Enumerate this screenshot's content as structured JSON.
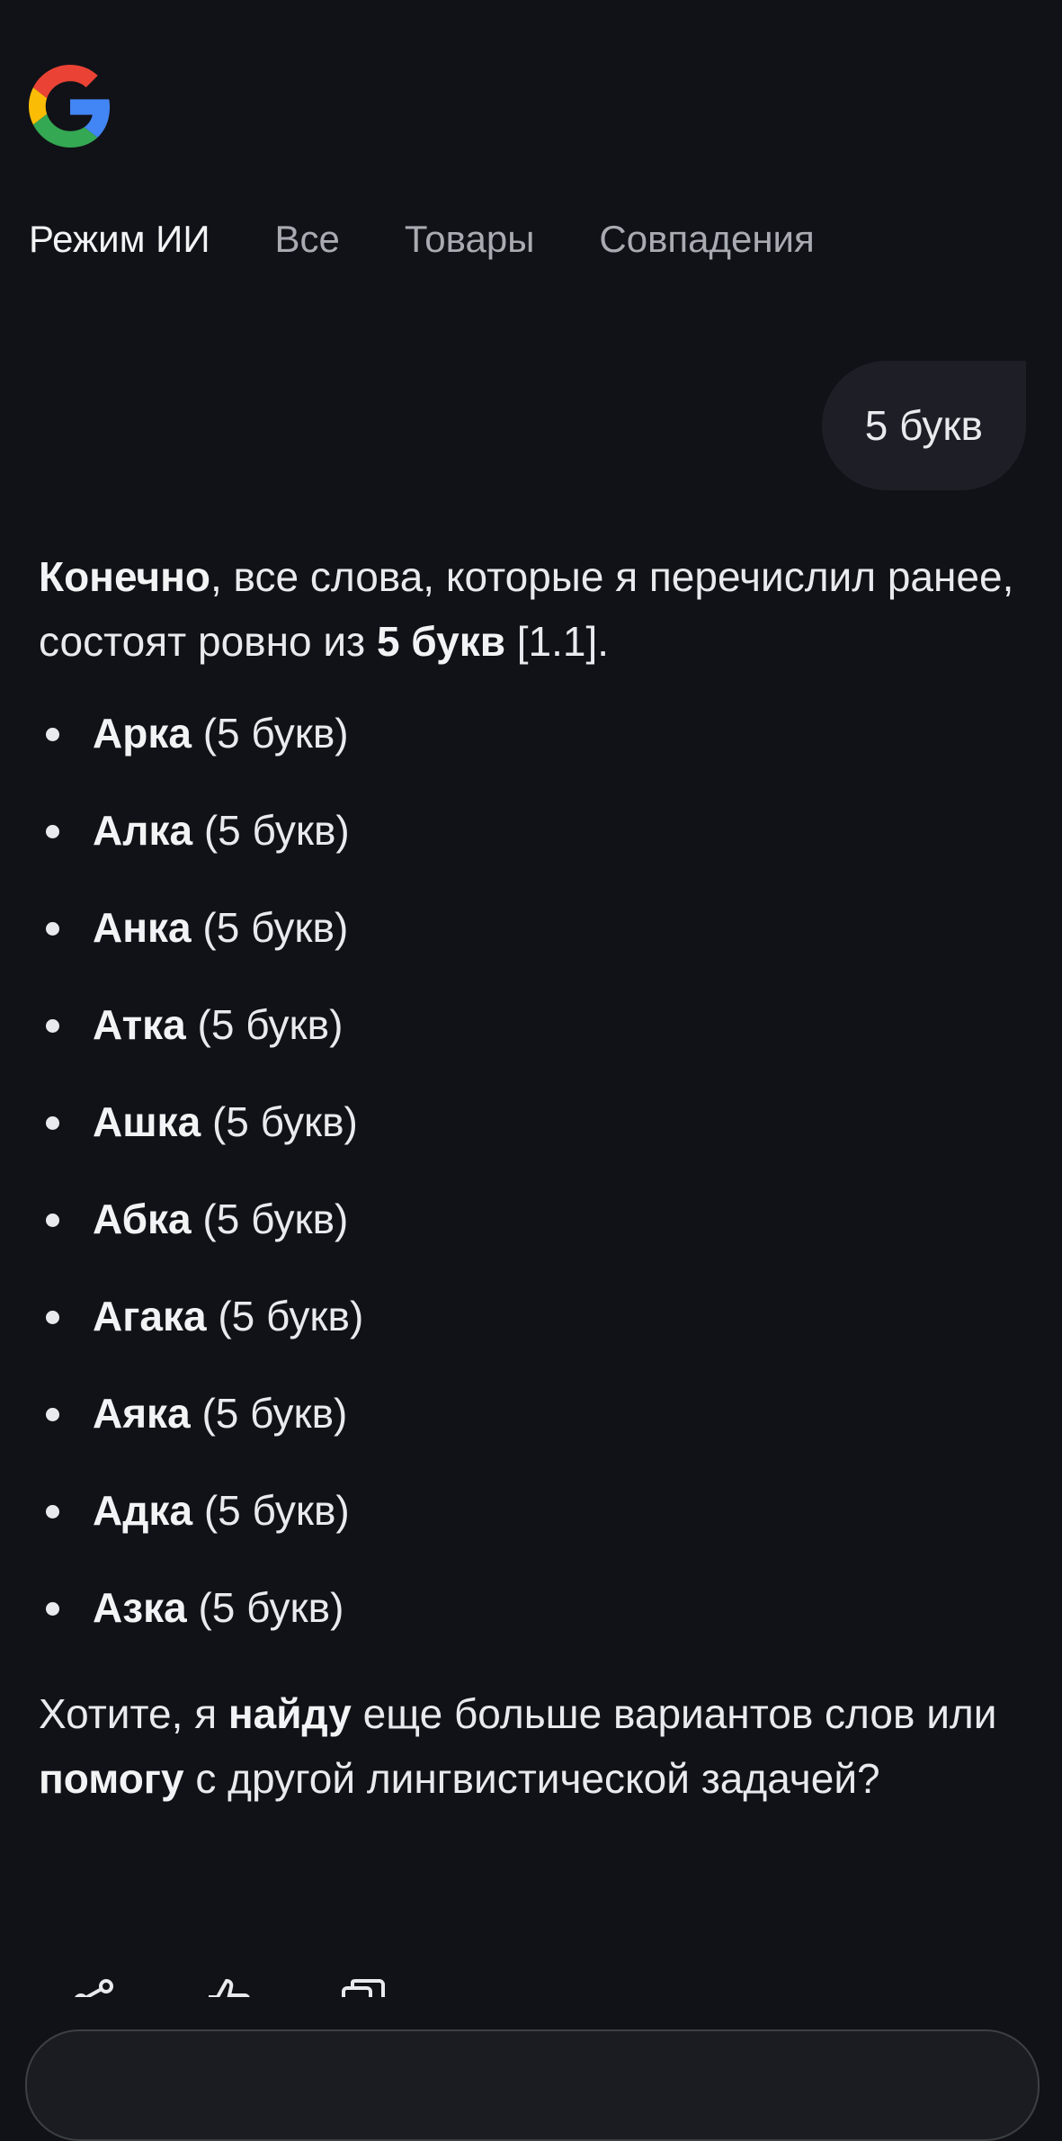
{
  "brand": {
    "logo_icon": "google-g-logo-icon",
    "colors": [
      "#4285F4",
      "#EA4335",
      "#FBBC05",
      "#34A853"
    ]
  },
  "tabs": [
    {
      "label": "Режим ИИ",
      "active": true
    },
    {
      "label": "Все",
      "active": false
    },
    {
      "label": "Товары",
      "active": false
    },
    {
      "label": "Совпадения",
      "active": false
    }
  ],
  "user_query": "5 букв",
  "answer": {
    "intro": {
      "bold1": "Конечно",
      "text1": ", все слова, которые я перечислил ранее, состоят ровно из ",
      "bold2": "5 букв",
      "text2": " [1.1]."
    },
    "items": [
      {
        "word": "Арка",
        "note": "(5 букв)"
      },
      {
        "word": "Алка",
        "note": "(5 букв)"
      },
      {
        "word": "Анка",
        "note": "(5 букв)"
      },
      {
        "word": "Атка",
        "note": "(5 букв)"
      },
      {
        "word": "Ашка",
        "note": "(5 букв)"
      },
      {
        "word": "Абка",
        "note": "(5 букв)"
      },
      {
        "word": "Агака",
        "note": "(5 букв)"
      },
      {
        "word": "Аяка",
        "note": "(5 букв)"
      },
      {
        "word": "Адка",
        "note": "(5 букв)"
      },
      {
        "word": "Азка",
        "note": "(5 букв)"
      }
    ],
    "outro": {
      "text1": "Хотите, я ",
      "bold1": "найду",
      "text2": " еще больше вариантов слов или ",
      "bold2": "помогу",
      "text3": " с другой лингвистической задачей?"
    }
  },
  "actions": [
    {
      "icon": "share-icon"
    },
    {
      "icon": "thumbs-up-icon"
    },
    {
      "icon": "copy-icon"
    }
  ]
}
